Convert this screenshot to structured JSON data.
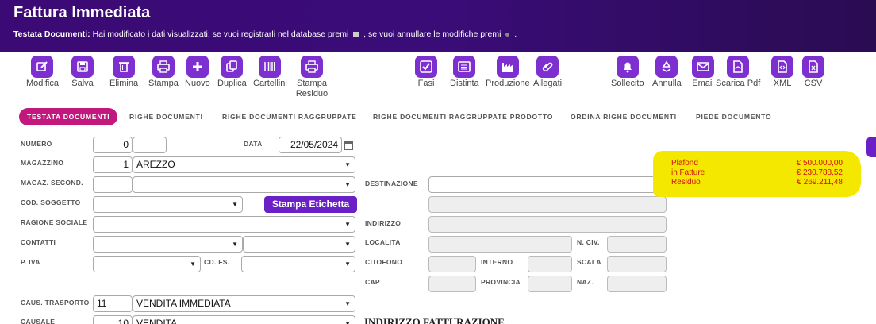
{
  "header": {
    "title": "Fattura Immediata",
    "message_bold": "Testata Documenti:",
    "message_text_1": " Hai modificato i dati visualizzati; se vuoi registrarli nel database premi ",
    "message_text_2": " , se vuoi annullare le modifiche premi ",
    "message_text_3": " ."
  },
  "toolbar": {
    "modifica": "Modifica",
    "salva": "Salva",
    "elimina": "Elimina",
    "stampa": "Stampa",
    "nuovo": "Nuovo",
    "duplica": "Duplica",
    "cartellini": "Cartellini",
    "stampa_residuo": "Stampa Residuo",
    "fasi": "Fasi",
    "distinta": "Distinta",
    "produzione": "Produzione",
    "allegati": "Allegati",
    "sollecito": "Sollecito",
    "annulla": "Annulla",
    "email": "Email",
    "scarica_pdf": "Scarica Pdf",
    "xml": "XML",
    "csv": "CSV"
  },
  "tabs": [
    "TESTATA DOCUMENTI",
    "RIGHE DOCUMENTI",
    "RIGHE DOCUMENTI RAGGRUPPATE",
    "RIGHE DOCUMENTI RAGGRUPPATE PRODOTTO",
    "ORDINA RIGHE DOCUMENTI",
    "PIEDE DOCUMENTO"
  ],
  "form": {
    "numero_label": "NUMERO",
    "numero_value": "0",
    "data_label": "DATA",
    "data_value": "22/05/2024",
    "magazzino_label": "MAGAZZINO",
    "magazzino_code": "1",
    "magazzino_name": "AREZZO",
    "magaz_second_label": "MAGAZ. SECOND.",
    "cod_soggetto_label": "COD. SOGGETTO",
    "stampa_etichetta": "Stampa Etichetta",
    "ragione_sociale_label": "RAGIONE SOCIALE",
    "contatti_label": "CONTATTI",
    "piva_label": "P. IVA",
    "cd_fs_label": "CD. FS.",
    "caus_trasporto_label": "CAUS. TRASPORTO",
    "caus_trasporto_code": "11",
    "caus_trasporto_value": "VENDITA IMMEDIATA",
    "causale_label": "CAUSALE",
    "causale_code": "10",
    "causale_value": "VENDITA",
    "destinazione_label": "DESTINAZIONE",
    "indirizzo_label": "INDIRIZZO",
    "localita_label": "LOCALITA",
    "n_civ_label": "N. CIV.",
    "citofono_label": "CITOFONO",
    "interno_label": "INTERNO",
    "scala_label": "SCALA",
    "cap_label": "CAP",
    "provincia_label": "PROVINCIA",
    "naz_label": "NAZ.",
    "indirizzo_fatturazione": "INDIRIZZO FATTURAZIONE"
  },
  "plafond": {
    "plafond_label": "Plafond",
    "plafond_value": "€ 500.000,00",
    "fatture_label": "in Fatture",
    "fatture_value": "€ 230.788,52",
    "residuo_label": "Residuo",
    "residuo_value": "€ 269.211,48"
  },
  "colors": {
    "header": "#3b0a74",
    "icon": "#7d2fd0",
    "active_tab": "#c2187e",
    "highlight": "#f5e800",
    "plafond_text": "#d01010"
  }
}
